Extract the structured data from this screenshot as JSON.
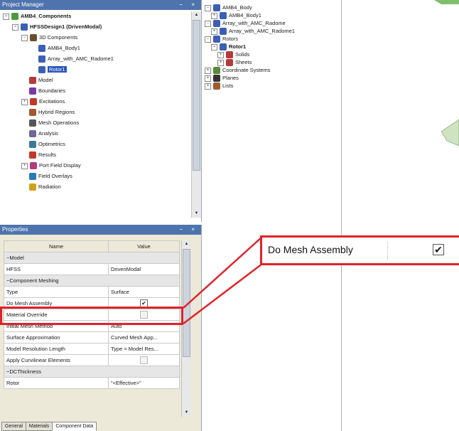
{
  "project_manager": {
    "title": "Project Manager",
    "controls": "− ×",
    "tree": [
      {
        "label": "AMB4_Components",
        "depth": 0,
        "icon": "#4c9a3c",
        "expander": "−",
        "bold": true
      },
      {
        "label": "HFSSDesign1 (DrivenModal)",
        "depth": 1,
        "icon": "#3a5fb5",
        "expander": "−",
        "bold": true
      },
      {
        "label": "3D Components",
        "depth": 2,
        "icon": "#6b4f2a",
        "expander": "−"
      },
      {
        "label": "AMB4_Body1",
        "depth": 3,
        "icon": "#3a5fb5"
      },
      {
        "label": "Array_with_AMC_Radome1",
        "depth": 3,
        "icon": "#3a5fb5"
      },
      {
        "label": "Rotor1",
        "depth": 3,
        "icon": "#3a5fb5",
        "selected": true
      },
      {
        "label": "Model",
        "depth": 2,
        "icon": "#b53a3a"
      },
      {
        "label": "Boundaries",
        "depth": 2,
        "icon": "#7a3aa5"
      },
      {
        "label": "Excitations",
        "depth": 2,
        "icon": "#c0392b",
        "expander": "+"
      },
      {
        "label": "Hybrid Regions",
        "depth": 2,
        "icon": "#a05a2c"
      },
      {
        "label": "Mesh Operations",
        "depth": 2,
        "icon": "#555555"
      },
      {
        "label": "Analysis",
        "depth": 2,
        "icon": "#6a6a9a"
      },
      {
        "label": "Optimetrics",
        "depth": 2,
        "icon": "#3a7a9a"
      },
      {
        "label": "Results",
        "depth": 2,
        "icon": "#c0392b"
      },
      {
        "label": "Port Field Display",
        "depth": 2,
        "icon": "#b53a7a",
        "expander": "+"
      },
      {
        "label": "Field Overlays",
        "depth": 2,
        "icon": "#2a7ab5"
      },
      {
        "label": "Radiation",
        "depth": 2,
        "icon": "#d4a017"
      }
    ]
  },
  "middle_tree": [
    {
      "label": "AMB4_Body",
      "depth": 0,
      "icon": "#3a5fb5",
      "expander": "−"
    },
    {
      "label": "AMB4_Body1",
      "depth": 1,
      "icon": "#3a5fb5",
      "expander": "+"
    },
    {
      "label": "Array_with_AMC_Radome",
      "depth": 0,
      "icon": "#3a5fb5",
      "expander": "−"
    },
    {
      "label": "Array_with_AMC_Radome1",
      "depth": 1,
      "icon": "#3a5fb5",
      "expander": "+"
    },
    {
      "label": "Rotors",
      "depth": 0,
      "icon": "#3a5fb5",
      "expander": "−"
    },
    {
      "label": "Rotor1",
      "depth": 1,
      "icon": "#3a5fb5",
      "expander": "−",
      "bold": true
    },
    {
      "label": "Solids",
      "depth": 2,
      "icon": "#b53a3a",
      "expander": "+"
    },
    {
      "label": "Sheets",
      "depth": 2,
      "icon": "#b53a3a",
      "expander": "+"
    },
    {
      "label": "Coordinate Systems",
      "depth": 0,
      "icon": "#5a8a3a",
      "expander": "+"
    },
    {
      "label": "Planes",
      "depth": 0,
      "icon": "#333333",
      "expander": "+"
    },
    {
      "label": "Lists",
      "depth": 0,
      "icon": "#a05a2c",
      "expander": "+"
    }
  ],
  "properties": {
    "title": "Properties",
    "controls": "− ×",
    "headers": {
      "name": "Name",
      "value": "Value"
    },
    "rows": [
      {
        "type": "group",
        "name": "−Model"
      },
      {
        "name": "HFSS",
        "value": "DrivenModal"
      },
      {
        "type": "group",
        "name": "−Component Meshing"
      },
      {
        "name": "Type",
        "value": "Surface"
      },
      {
        "name": "Do Mesh Assembly",
        "check": true
      },
      {
        "name": "Material Override",
        "check": false,
        "dim": true
      },
      {
        "name": "Initial Mesh Method",
        "value": "Auto"
      },
      {
        "name": "Surface Approximation",
        "value": "Curved Mesh App..."
      },
      {
        "name": "Model Resolution Length",
        "value": "Type = Model Res..."
      },
      {
        "name": "Apply Curvilinear Elements",
        "check": false,
        "dim": true
      },
      {
        "type": "group",
        "name": "−DCThickness"
      },
      {
        "name": "Rotor",
        "value": "\"<Effective>\""
      }
    ],
    "tabs": [
      "General",
      "Materials",
      "Component Data"
    ],
    "active_tab": "Component Data"
  },
  "callout": {
    "label": "Do Mesh Assembly",
    "checked_glyph": "✔"
  },
  "colors": {
    "highlight": "#e0232b",
    "titlebar": "#4f74ad",
    "selection": "#2a56b8"
  }
}
